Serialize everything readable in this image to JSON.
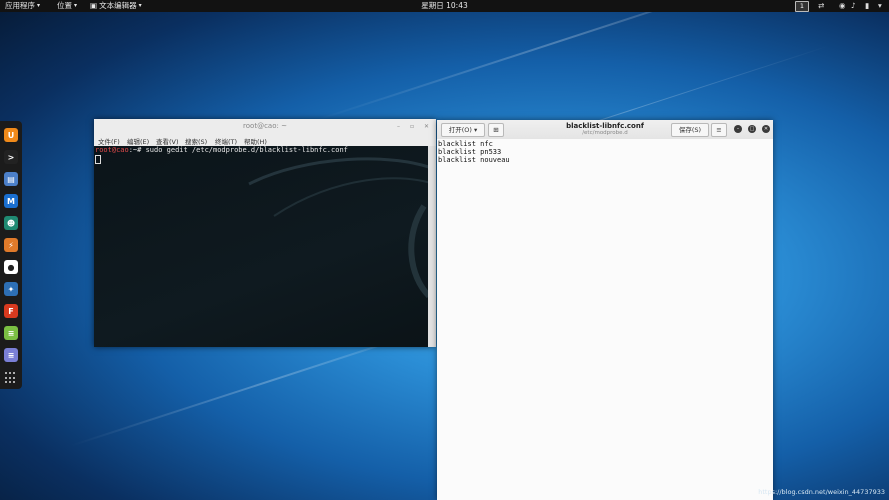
{
  "topbar": {
    "applications": "应用程序",
    "places": "位置",
    "text_editor": "文本编辑器",
    "clock": "星期日 10:43",
    "workspace": "1"
  },
  "dock": {
    "apps": [
      {
        "icon": "firefox-icon",
        "color": "#f08a1a",
        "glyph": "U"
      },
      {
        "icon": "terminal-icon",
        "color": "#222222",
        "glyph": ">"
      },
      {
        "icon": "files-icon",
        "color": "#4b7fc9",
        "glyph": "▤"
      },
      {
        "icon": "metasploit-icon",
        "color": "#1a6fd0",
        "glyph": "M"
      },
      {
        "icon": "armitage-icon",
        "color": "#1f8a72",
        "glyph": "☻"
      },
      {
        "icon": "burpsuite-icon",
        "color": "#e07a2a",
        "glyph": "⚡"
      },
      {
        "icon": "maltego-icon",
        "color": "#ffffff",
        "glyph": "●"
      },
      {
        "icon": "beef-icon",
        "color": "#2d6fb5",
        "glyph": "✦"
      },
      {
        "icon": "faraday-icon",
        "color": "#d83a1f",
        "glyph": "F"
      },
      {
        "icon": "leafpad-icon",
        "color": "#7bc043",
        "glyph": "≡"
      },
      {
        "icon": "notes-icon",
        "color": "#7a7fd6",
        "glyph": "≡"
      }
    ]
  },
  "terminal": {
    "title": "root@cao: ~",
    "menu": [
      "文件(F)",
      "编辑(E)",
      "查看(V)",
      "搜索(S)",
      "终端(T)",
      "帮助(H)"
    ],
    "prompt_user": "root@cao",
    "prompt_rest": ":~# ",
    "command": "sudo gedit /etc/modprobe.d/blacklist-libnfc.conf"
  },
  "gedit": {
    "open_label": "打开(O)",
    "save_label": "保存(S)",
    "title": "blacklist-libnfc.conf",
    "subtitle": "/etc/modprobe.d",
    "lines": [
      "blacklist nfc",
      "blacklist pn533",
      "blacklist nouveau"
    ]
  },
  "watermark": "https://blog.csdn.net/weixin_44737933"
}
